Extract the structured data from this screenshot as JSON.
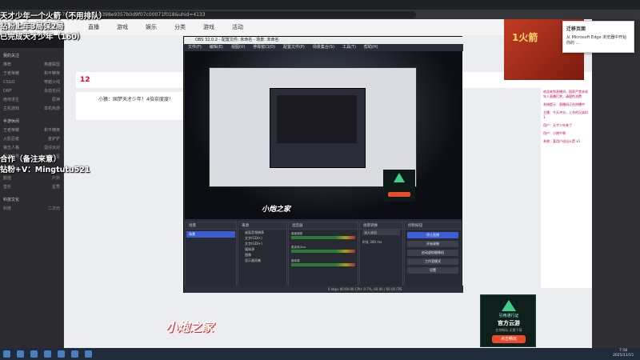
{
  "browser": {
    "url": "...e76a94-11f4d0a8398e9357b0d9f07c00071f018&uhid=4133",
    "popup_title": "迁移页面",
    "popup_text": "从 Microsoft Edge 浏览器中开始你的 ..."
  },
  "site_header": {
    "nav": [
      "直播",
      "游戏",
      "娱乐",
      "分类",
      "游戏",
      "活动"
    ]
  },
  "overlay": {
    "lines": [
      "天才少年一个火箭（不用排队）",
      "钻粉上车3局保2局",
      "已完成天才少年（160）"
    ],
    "contact_title": "合作（备注来意）",
    "contact_id": "钻粉+V：Mingtutu521"
  },
  "room": {
    "number": "12",
    "anchor_title": "小猿：国梦天才少年！4倍奈度度！",
    "ad_text": "1火箭"
  },
  "sidebar": {
    "sections": [
      {
        "head": "我的关注",
        "rows": [
          [
            "推荐",
            "英雄联盟"
          ],
          [
            "王者荣耀",
            "和平精英"
          ],
          [
            "CSGO",
            "穿越火线"
          ],
          [
            "DNF",
            "永劫无间"
          ],
          [
            "绝地求生",
            "原神"
          ],
          [
            "主机游戏",
            "单机热游"
          ]
        ]
      },
      {
        "head": "手游休闲",
        "rows": [
          [
            "王者荣耀",
            "和平精英"
          ],
          [
            "火影忍者",
            "金铲铲"
          ],
          [
            "第五人格",
            "蛋仔派对"
          ],
          [
            "我的世界",
            "元梦之星"
          ]
        ]
      },
      {
        "head": "娱乐天地",
        "rows": [
          [
            "颜值",
            "户外"
          ],
          [
            "音乐",
            "星秀"
          ]
        ]
      },
      {
        "head": "科技文化",
        "rows": [
          [
            "科技",
            "二次元"
          ]
        ]
      }
    ]
  },
  "obs": {
    "title": "OBS 32.0.2 - 配置文件: 未命名 - 场景: 未命名",
    "menu": [
      "文件(F)",
      "编辑(E)",
      "视图(V)",
      "停靠窗口(D)",
      "配置文件(P)",
      "场景集合(S)",
      "工具(T)",
      "帮助(H)"
    ],
    "logo": "小炮之家",
    "docks": {
      "scenes": {
        "title": "场景",
        "items": [
          "场景"
        ]
      },
      "sources": {
        "title": "来源",
        "items": [
          "桌面音频捕获",
          "文字(GDI+)",
          "文字(GDI+)",
          "媒体源",
          "图像",
          "显示器采集"
        ]
      },
      "mixer": {
        "title": "混音器",
        "channels": [
          "桌面音频",
          "麦克风/Aux",
          "媒体源"
        ]
      },
      "transitions": {
        "title": "场景转换",
        "type": "淡入淡出",
        "duration_label": "时长",
        "duration": "300 ms"
      },
      "controls": {
        "title": "控制按钮",
        "buttons": [
          "停止直播",
          "开始录制",
          "启动虚拟摄像机",
          "工作室模式",
          "设置"
        ]
      }
    },
    "status": "0 kbps    00:00:00    CPU: 0.7%, 60.00 / 60.00 FPS"
  },
  "bottom_logo": "小炮之家",
  "promo": {
    "brand": "引用通行证",
    "title": "官方云游",
    "subtitle": "在线畅玩 无需下载",
    "button": "点击畅玩"
  },
  "taskbar": {
    "time": "7:58",
    "date": "2025/11/15"
  },
  "chat": [
    "欢迎来到直播间，国家严禁未成年人直播打赏，请理性消费",
    "系统提示：直播间正在热播中",
    "主播：今天冲分，上车的兄弟扣1",
    "用户：天才少年来了",
    "用户：小炮牛啊",
    "系统：某用户送出火箭 x1"
  ],
  "colors": {
    "obs_accent": "#3d5ed6",
    "overlay_text": "#ffffff",
    "live_red": "#e84c2d"
  }
}
